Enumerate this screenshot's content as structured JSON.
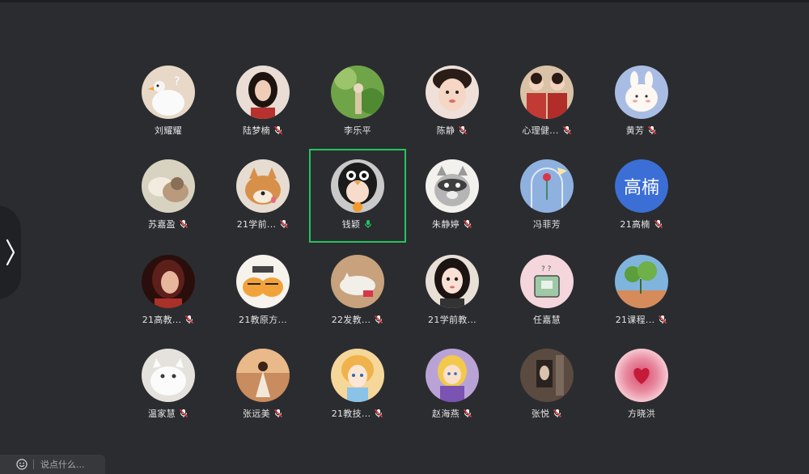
{
  "participants": [
    {
      "name": "刘耀耀",
      "muted": false,
      "avatar": "duck-photo"
    },
    {
      "name": "陆梦楠",
      "muted": true,
      "avatar": "woman-portrait"
    },
    {
      "name": "李乐平",
      "muted": false,
      "avatar": "green-photo"
    },
    {
      "name": "陈静",
      "muted": true,
      "avatar": "child-photo"
    },
    {
      "name": "心理健...",
      "muted": true,
      "avatar": "group-photo"
    },
    {
      "name": "黄芳",
      "muted": true,
      "avatar": "bunny-cartoon"
    },
    {
      "name": "苏嘉盈",
      "muted": true,
      "avatar": "dog-blanket"
    },
    {
      "name": "21学前...",
      "muted": true,
      "avatar": "shiba-dog"
    },
    {
      "name": "钱颖",
      "muted": false,
      "speaking": true,
      "host": true,
      "avatar": "penguin-costume"
    },
    {
      "name": "朱静婷",
      "muted": true,
      "avatar": "raccoon-drawing"
    },
    {
      "name": "冯菲芳",
      "muted": false,
      "avatar": "rose-dome"
    },
    {
      "name": "21高楠",
      "muted": true,
      "avatar_text": "高楠"
    },
    {
      "name": "21高教...",
      "muted": true,
      "avatar": "red-portrait"
    },
    {
      "name": "21教原方...",
      "muted": false,
      "avatar": "tiger-cartoon"
    },
    {
      "name": "22发教...",
      "muted": true,
      "avatar": "cat-sleeping"
    },
    {
      "name": "21学前教...",
      "muted": false,
      "avatar": "anime-girl"
    },
    {
      "name": "任嘉慧",
      "muted": false,
      "avatar": "book-cartoon"
    },
    {
      "name": "21课程...",
      "muted": true,
      "avatar": "plant-photo"
    },
    {
      "name": "温家慧",
      "muted": true,
      "avatar": "white-cat"
    },
    {
      "name": "张远美",
      "muted": true,
      "avatar": "girl-outdoor"
    },
    {
      "name": "21教技...",
      "muted": true,
      "avatar": "anime-princess"
    },
    {
      "name": "赵海燕",
      "muted": true,
      "avatar": "rapunzel"
    },
    {
      "name": "张悦",
      "muted": true,
      "avatar": "dark-room"
    },
    {
      "name": "方晓洪",
      "muted": false,
      "avatar": "pink-heart"
    }
  ],
  "chat": {
    "placeholder": "说点什么..."
  },
  "colors": {
    "background": "#2b2c30",
    "active_border": "#22c55e",
    "mic_speaking": "#22c55e",
    "mic_muted": "#ffffff"
  }
}
